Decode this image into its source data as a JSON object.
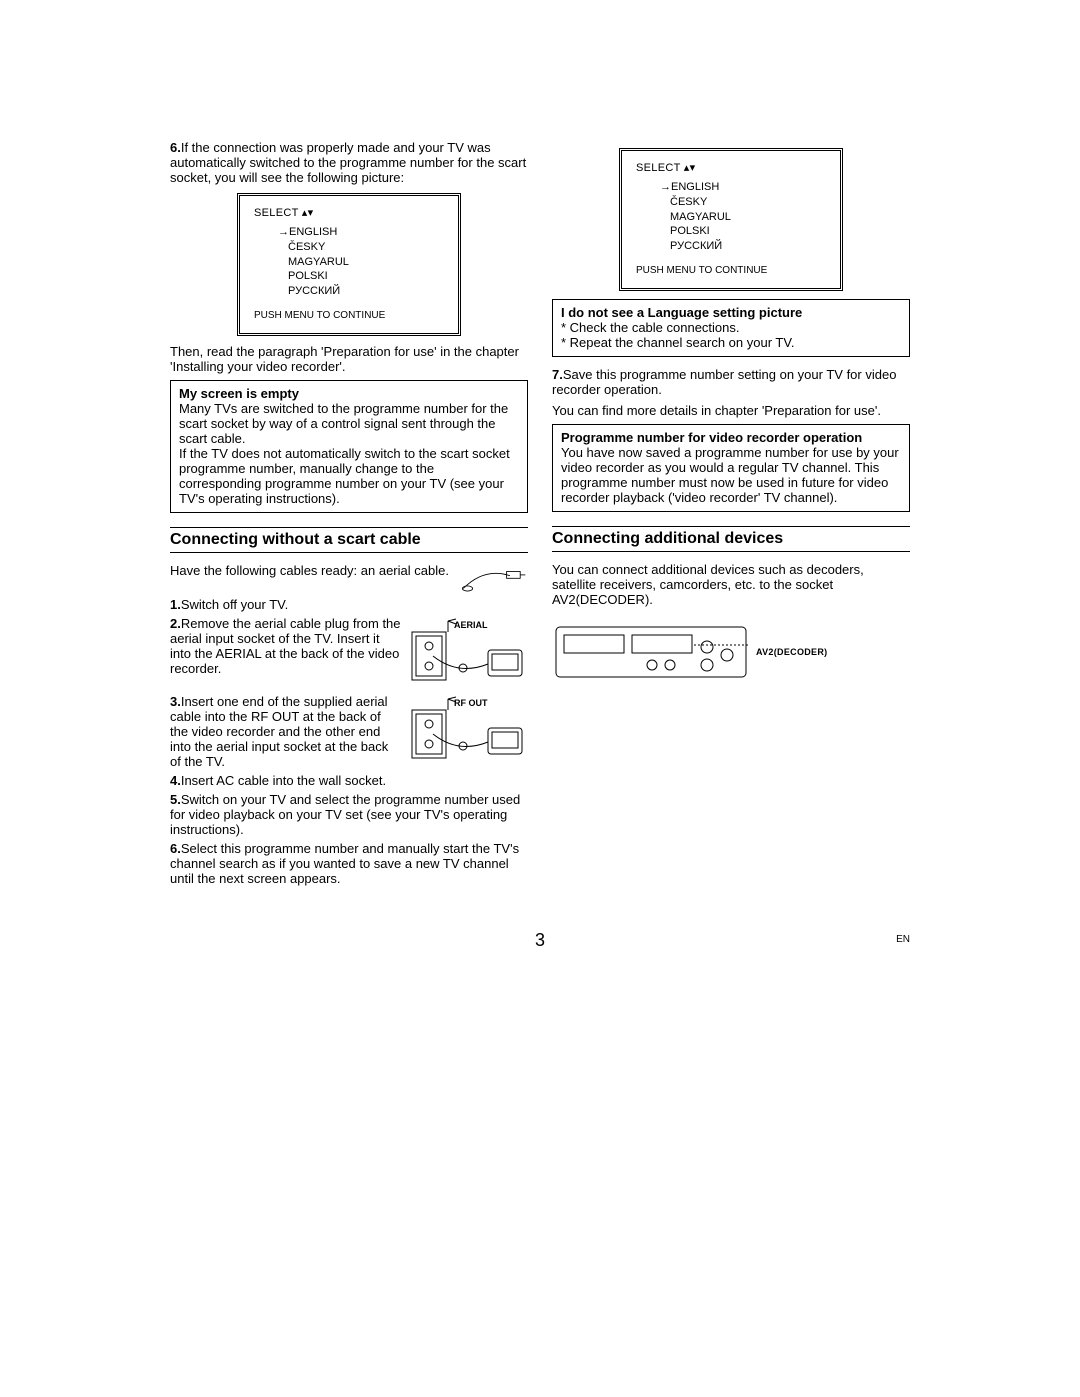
{
  "left": {
    "step6": {
      "num": "6.",
      "text": "If the connection was properly made and your TV was automatically switched to the programme number for the scart socket, you will see the following picture:"
    },
    "screen": {
      "select": "SELECT ▴▾",
      "arrow": "→",
      "langs": [
        "ENGLISH",
        "ČESKY",
        "MAGYARUL",
        "POLSKI",
        "РУССКИЙ"
      ],
      "continue": "PUSH MENU TO CONTINUE"
    },
    "afterScreen": "Then, read the paragraph 'Preparation for use' in the chapter 'Installing your video recorder'.",
    "box1": {
      "title": "My screen is empty",
      "body1": "Many TVs are switched to the programme number for the scart socket by way of a control signal sent through the scart cable.",
      "body2": "If the TV does not automatically switch to the scart socket programme number, manually change to the corresponding programme number on your TV (see your TV's operating instructions)."
    },
    "section1": "Connecting without a scart cable",
    "cablesReady": "Have the following cables ready: an aerial cable.",
    "steps": {
      "s1": {
        "num": "1.",
        "text": "Switch off your TV."
      },
      "s2": {
        "num": "2.",
        "text": "Remove the aerial cable plug from the aerial input socket of the TV. Insert it into the AERIAL at the back of the video recorder."
      },
      "s3": {
        "num": "3.",
        "text": "Insert one end of the supplied aerial cable into the RF OUT at the back of the video recorder and the other end into the aerial input socket at the back of the TV."
      },
      "s4": {
        "num": "4.",
        "text": "Insert AC cable into the wall socket."
      },
      "s5": {
        "num": "5.",
        "text": "Switch on your TV and select the programme number used for video playback on your TV set (see your TV's operating instructions)."
      },
      "s6b": {
        "num": "6.",
        "text": "Select this programme number and manually start the TV's channel search as if you wanted to save a new TV channel until the next screen appears."
      }
    },
    "diag2Label": "AERIAL",
    "diag3Label": "RF OUT"
  },
  "right": {
    "screen": {
      "select": "SELECT ▴▾",
      "arrow": "→",
      "langs": [
        "ENGLISH",
        "ČESKY",
        "MAGYARUL",
        "POLSKI",
        "РУССКИЙ"
      ],
      "continue": "PUSH MENU TO CONTINUE"
    },
    "box2": {
      "title": "I do not see a Language setting picture",
      "line1": "* Check the cable connections.",
      "line2": "* Repeat the channel search on your TV."
    },
    "step7": {
      "num": "7.",
      "text": "Save this programme number setting on your TV for video recorder operation."
    },
    "after7": "You can find more details in chapter 'Preparation for use'.",
    "box3": {
      "title": "Programme number for video recorder operation",
      "body": "You have now saved a programme number for use by your video recorder as you would a regular TV channel. This programme number must now be used in future for video recorder playback ('video recorder' TV channel)."
    },
    "section2": "Connecting additional devices",
    "additionalText": "You can connect additional devices such as decoders, satellite receivers, camcorders, etc. to the socket AV2(DECODER).",
    "av2Label": "AV2(DECODER)"
  },
  "footer": {
    "pageNum": "3",
    "lang": "EN"
  }
}
